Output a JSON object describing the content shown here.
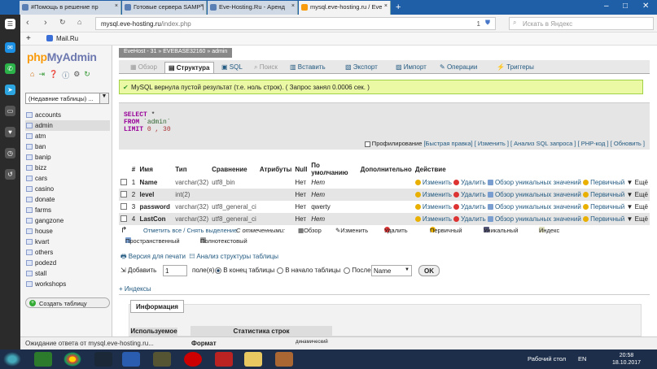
{
  "tabs": [
    {
      "label": "#Помощь в решение пр"
    },
    {
      "label": "Готовые сервера SAMP |"
    },
    {
      "label": "Eve-Hosting.Ru - Аренд"
    },
    {
      "label": "mysql.eve-hosting.ru / Eve"
    }
  ],
  "addr": {
    "url_host": "mysql.eve-hosting.ru",
    "url_path": "/index.php",
    "search_placeholder": "Искать в Яндекс",
    "count": "1"
  },
  "bookmarks": {
    "mail": "Mail.Ru"
  },
  "pma": {
    "logo_a": "php",
    "logo_b": "MyAdmin",
    "db_select": "(Недавние таблицы) ...",
    "tables": [
      "accounts",
      "admin",
      "atm",
      "ban",
      "banip",
      "bizz",
      "cars",
      "casino",
      "donate",
      "farms",
      "gangzone",
      "house",
      "kvart",
      "others",
      "podezd",
      "stall",
      "workshops"
    ],
    "create_table": "Создать таблицу"
  },
  "crumb": {
    "server": "EveHost - 31",
    "db": "EVEBASE32160",
    "table": "admin"
  },
  "menu": [
    "Обзор",
    "Структура",
    "SQL",
    "Поиск",
    "Вставить",
    "Экспорт",
    "Импорт",
    "Операции",
    "Триггеры"
  ],
  "success": "MySQL вернула пустой результат (т.е. ноль строк). ( Запрос занял 0.0006 сек. )",
  "sql": {
    "select": "SELECT",
    "star": "*",
    "from": "FROM",
    "table": "`admin`",
    "limit": "LIMIT",
    "nums": "0 , 30"
  },
  "sqllinks": {
    "prof": "Профилирование",
    "fast": "[Быстрая правка]",
    "edit": "[ Изменить ]",
    "analyze": "[ Анализ SQL запроса ]",
    "php": "[ PHP-код ]",
    "refresh": "[ Обновить ]"
  },
  "columns": {
    "hdr": [
      "#",
      "Имя",
      "Тип",
      "Сравнение",
      "Атрибуты",
      "Null",
      "По умолчанию",
      "Дополнительно",
      "Действие"
    ],
    "rows": [
      {
        "n": "1",
        "name": "Name",
        "type": "varchar(32)",
        "coll": "utf8_bin",
        "null": "Нет",
        "def": "Нет"
      },
      {
        "n": "2",
        "name": "level",
        "type": "int(2)",
        "coll": "",
        "null": "Нет",
        "def": "Нет"
      },
      {
        "n": "3",
        "name": "password",
        "type": "varchar(32)",
        "coll": "utf8_general_ci",
        "null": "Нет",
        "def": "qwerty"
      },
      {
        "n": "4",
        "name": "LastCon",
        "type": "varchar(32)",
        "coll": "utf8_general_ci",
        "null": "Нет",
        "def": "Нет"
      }
    ],
    "actions": {
      "edit": "Изменить",
      "del": "Удалить",
      "uniq": "Обзор уникальных значений",
      "prim": "Первичный",
      "more": "Ещё"
    }
  },
  "batch": {
    "check": "Отметить все / Снять выделение",
    "sel": "С отмеченными:",
    "browse": "Обзор",
    "edit": "Изменить",
    "del": "Удалить",
    "prim": "Первичный",
    "unique": "Уникальный",
    "index": "Индекс",
    "spatial": "Пространственный",
    "fulltext": "Полнотекстовый"
  },
  "links2": {
    "print": "Версия для печати",
    "analyze": "Анализ структуры таблицы"
  },
  "addrow": {
    "label": "Добавить",
    "value": "1",
    "fields": "поле(я)",
    "end": "В конец таблицы",
    "start": "В начало таблицы",
    "after": "После",
    "after_sel": "Name",
    "ok": "OK"
  },
  "indexes": "+ Индексы",
  "info": {
    "label": "Информация",
    "used": "Используемое пространство",
    "stat": "Статистика строк",
    "format": "Формат",
    "dynamic": "динамический"
  },
  "status": "Ожидание ответа от mysql.eve-hosting.ru...",
  "taskbar": {
    "desktop": "Рабочий стол",
    "lang": "EN",
    "time": "20:58",
    "date": "18.10.2017"
  }
}
